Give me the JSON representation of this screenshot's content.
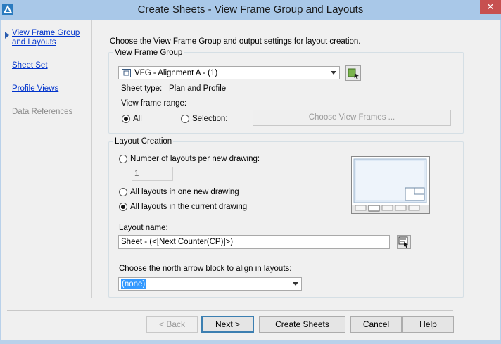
{
  "window": {
    "title": "Create Sheets - View Frame Group and Layouts",
    "close_glyph": "✕"
  },
  "nav": {
    "items": [
      {
        "label_line1": "View Frame Group",
        "label_line2": "and Layouts",
        "active": true
      },
      {
        "label": "Sheet Set"
      },
      {
        "label": "Profile Views"
      },
      {
        "label": "Data References",
        "disabled": true
      }
    ]
  },
  "main": {
    "instruction": "Choose the View Frame Group and output settings for layout creation.",
    "vfg": {
      "group_title": "View Frame Group",
      "selected": "VFG - Alignment A - (1)",
      "sheet_type_label": "Sheet type:",
      "sheet_type_value": "Plan and Profile",
      "range_label": "View frame range:",
      "range_all": "All",
      "range_selection": "Selection:",
      "choose_button": "Choose View Frames ..."
    },
    "layout": {
      "group_title": "Layout Creation",
      "opt_per_drawing": "Number of layouts per new drawing:",
      "per_drawing_value": "1",
      "opt_one_new": "All layouts in one new drawing",
      "opt_current": "All layouts in the current drawing",
      "name_label": "Layout name:",
      "name_value": "Sheet - (<[Next Counter(CP)]>)",
      "north_label": "Choose the north arrow block to align in layouts:",
      "north_value": "(none)"
    }
  },
  "footer": {
    "back": "< Back",
    "next": "Next >",
    "create": "Create Sheets",
    "cancel": "Cancel",
    "help": "Help"
  },
  "colors": {
    "link": "#0033cc",
    "close": "#c75050",
    "titlebar": "#a9c8e8"
  }
}
